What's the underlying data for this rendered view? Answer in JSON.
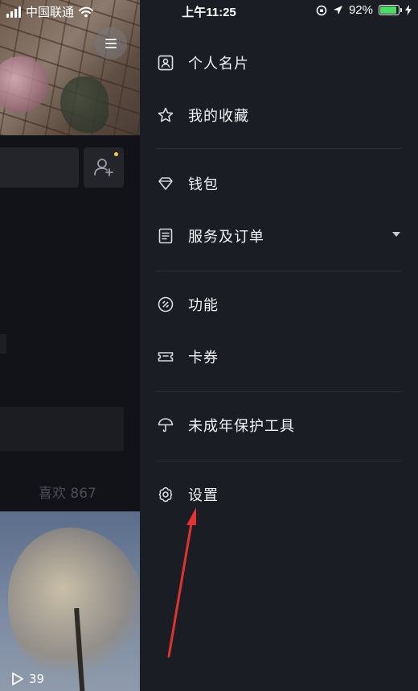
{
  "status_bar": {
    "carrier": "中国联通",
    "time": "上午11:25",
    "battery_percent": "92%",
    "battery_level": 0.92,
    "battery_color": "#4cd964"
  },
  "background_page": {
    "likes_label": "喜欢 867",
    "play_count": "39",
    "menu_icon": "hamburger-icon",
    "add_friend_icon": "add-user-icon",
    "notification_dot_color": "#f7c948"
  },
  "drawer": {
    "groups": [
      [
        {
          "id": "profile-card",
          "label": "个人名片",
          "icon": "id-card-icon"
        },
        {
          "id": "favorites",
          "label": "我的收藏",
          "icon": "star-icon"
        }
      ],
      [
        {
          "id": "wallet",
          "label": "钱包",
          "icon": "diamond-icon"
        },
        {
          "id": "services-orders",
          "label": "服务及订单",
          "icon": "document-icon",
          "expandable": true
        }
      ],
      [
        {
          "id": "features",
          "label": "功能",
          "icon": "link-icon"
        },
        {
          "id": "coupons",
          "label": "卡券",
          "icon": "ticket-icon"
        }
      ],
      [
        {
          "id": "minor-protection",
          "label": "未成年保护工具",
          "icon": "umbrella-icon"
        }
      ],
      [
        {
          "id": "settings",
          "label": "设置",
          "icon": "gear-icon"
        }
      ]
    ]
  },
  "annotation": {
    "color": "#e0322f",
    "points_to": "settings"
  }
}
